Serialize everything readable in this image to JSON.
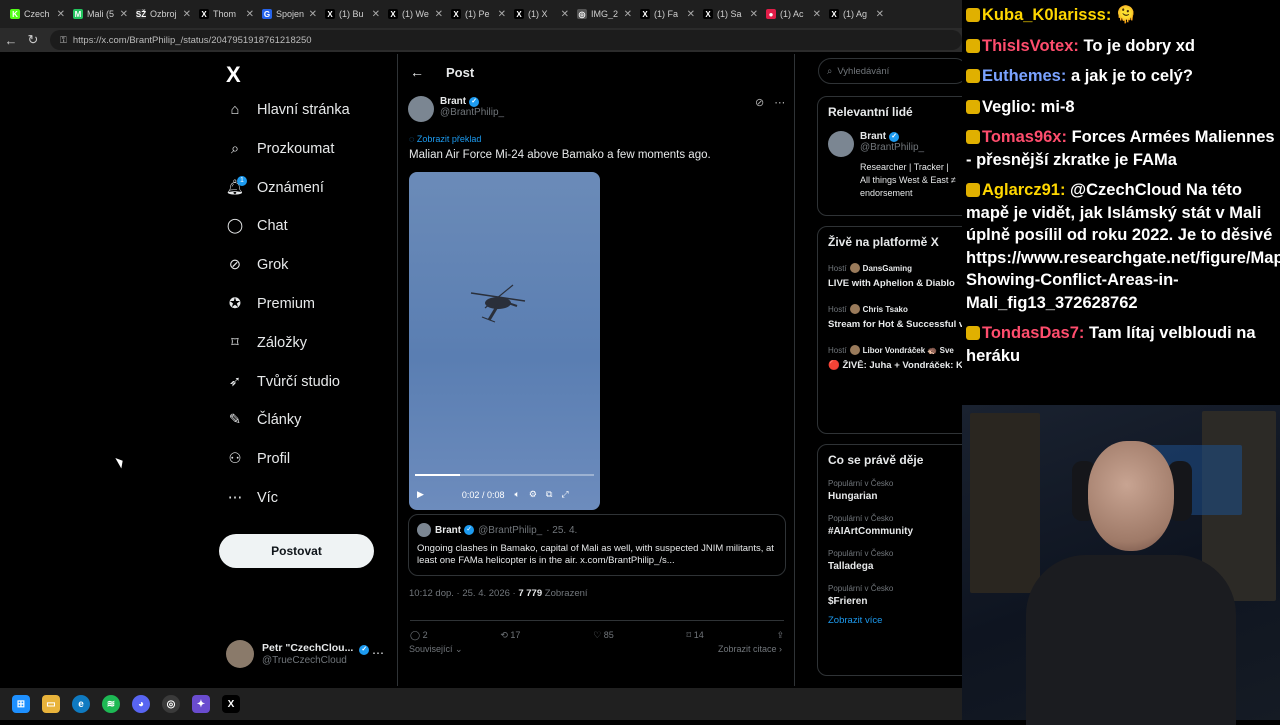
{
  "browser": {
    "tabs": [
      {
        "label": "Czech",
        "color": "#53fc18",
        "glyph": "K"
      },
      {
        "label": "Mali (5",
        "color": "#22c55e",
        "glyph": "M"
      },
      {
        "label": "Ozbroj",
        "color": "#333333",
        "glyph": "SŽ"
      },
      {
        "label": "Thom",
        "color": "#000000",
        "glyph": "X"
      },
      {
        "label": "Spojen",
        "color": "#2563eb",
        "glyph": "G"
      },
      {
        "label": "(1) Bu",
        "color": "#000000",
        "glyph": "X"
      },
      {
        "label": "(1) We",
        "color": "#000000",
        "glyph": "X"
      },
      {
        "label": "(1) Pe",
        "color": "#000000",
        "glyph": "X"
      },
      {
        "label": "(1) X",
        "color": "#000000",
        "glyph": "X"
      },
      {
        "label": "IMG_2",
        "color": "#555555",
        "glyph": "◎"
      },
      {
        "label": "(1) Fa",
        "color": "#000000",
        "glyph": "X"
      },
      {
        "label": "(1) Sa",
        "color": "#000000",
        "glyph": "X"
      },
      {
        "label": "(1) Ac",
        "color": "#e11d48",
        "glyph": "●"
      },
      {
        "label": "(1) Ag",
        "color": "#000000",
        "glyph": "X"
      }
    ],
    "url": "https://x.com/BrantPhilip_/status/2047951918761218250"
  },
  "sidebar": {
    "logo": "X",
    "items": [
      {
        "label": "Hlavní stránka",
        "icon": "home-icon",
        "glyph": "⌂"
      },
      {
        "label": "Prozkoumat",
        "icon": "search-icon",
        "glyph": "⌕"
      },
      {
        "label": "Oznámení",
        "icon": "bell-icon",
        "glyph": "🔔︎"
      },
      {
        "label": "Chat",
        "icon": "chat-icon",
        "glyph": "◯"
      },
      {
        "label": "Grok",
        "icon": "grok-icon",
        "glyph": "⊘"
      },
      {
        "label": "Premium",
        "icon": "premium-icon",
        "glyph": "✪"
      },
      {
        "label": "Záložky",
        "icon": "bookmark-icon",
        "glyph": "⌑"
      },
      {
        "label": "Tvůrčí studio",
        "icon": "rocket-icon",
        "glyph": "➶"
      },
      {
        "label": "Články",
        "icon": "article-icon",
        "glyph": "✎"
      },
      {
        "label": "Profil",
        "icon": "profile-icon",
        "glyph": "⚇"
      },
      {
        "label": "Víc",
        "icon": "more-icon",
        "glyph": "⋯"
      }
    ],
    "notif_count": "1",
    "post_button": "Postovat",
    "account_name": "Petr \"CzechClou...",
    "account_handle": "@TrueCzechCloud"
  },
  "post": {
    "header_title": "Post",
    "author_name": "Brant",
    "author_handle": "@BrantPhilip_",
    "translate_link": "Zobrazit překlad",
    "text": "Malian Air Force Mi-24 above Bamako a few moments ago.",
    "video_time": "0:02 / 0:08",
    "video_progress": 0.25,
    "quote": {
      "name": "Brant",
      "handle": "@BrantPhilip_",
      "date": "· 25. 4.",
      "text": "Ongoing clashes in Bamako, capital of Mali as well, with suspected JNIM militants, at least one FAMa helicopter is in the air. x.com/BrantPhilip_/s..."
    },
    "timestamp": "10:12 dop. · 25. 4. 2026 · ",
    "views": "7 779",
    "views_label": " Zobrazení",
    "replies": "2",
    "reposts": "17",
    "likes": "85",
    "bookmarks": "14",
    "related_label": "Související",
    "citations_label": "Zobrazit citace"
  },
  "right": {
    "search_placeholder": "Vyhledávání",
    "relevant_title": "Relevantní lidé",
    "relevant_name": "Brant",
    "relevant_handle": "@BrantPhilip_",
    "relevant_bio": "Researcher | Tracker | All things West & East ≠ endorsement",
    "live_title": "Živě na platformě X",
    "live": [
      {
        "prefix": "Hostí",
        "host": "DansGaming",
        "title": "LIVE with Aphelion & Diablo"
      },
      {
        "prefix": "Hostí",
        "host": "Chris Tsako",
        "title": "Stream for Hot & Successful viewers. Hearthstones! Clas"
      },
      {
        "prefix": "Hostí",
        "host": "Libor Vondráček 🦔 Sve",
        "title": "🔴 ŽIVĚ: Juha + Vondráček: Kůrovec pod kontrolou, ale"
      }
    ],
    "trends_title": "Co se právě děje",
    "trends": [
      {
        "category": "Populární v Česko",
        "name": "Hungarian"
      },
      {
        "category": "Populární v Česko",
        "name": "#AIArtCommunity"
      },
      {
        "category": "Populární v Česko",
        "name": "Talladega"
      },
      {
        "category": "Populární v Česko",
        "name": "$Frieren"
      }
    ],
    "show_more": "Zobrazit více"
  },
  "chat": [
    {
      "user": "Kuba_K0larisss:",
      "color": "#ffd700",
      "text": " 🫠"
    },
    {
      "user": "ThisIsVotex:",
      "color": "#ff4d6d",
      "text": " To je dobry xd"
    },
    {
      "user": "Euthemes:",
      "color": "#7aa2ff",
      "text": " a jak je to celý?"
    },
    {
      "user": "Veglio:",
      "color": "#ffffff",
      "text": " mi-8"
    },
    {
      "user": "Tomas96x:",
      "color": "#ff4d6d",
      "text": " Forces Armées Maliennes - přesnější zkratke je FAMa"
    },
    {
      "user": "Aglarcz91:",
      "color": "#ffd700",
      "text": " @CzechCloud Na této mapě je vidět, jak Islámský stát v Mali úplně posílil od roku 2022. Je to děsivé https://www.researchgate.net/figure/Map-Showing-Conflict-Areas-in-Mali_fig13_372628762"
    },
    {
      "user": "TondasDas7:",
      "color": "#ff4d6d",
      "text": " Tam lítaj velbloudi na heráku"
    }
  ],
  "colors": {
    "accent": "#1d9bf0",
    "bg": "#000000",
    "border": "#2f3336"
  }
}
